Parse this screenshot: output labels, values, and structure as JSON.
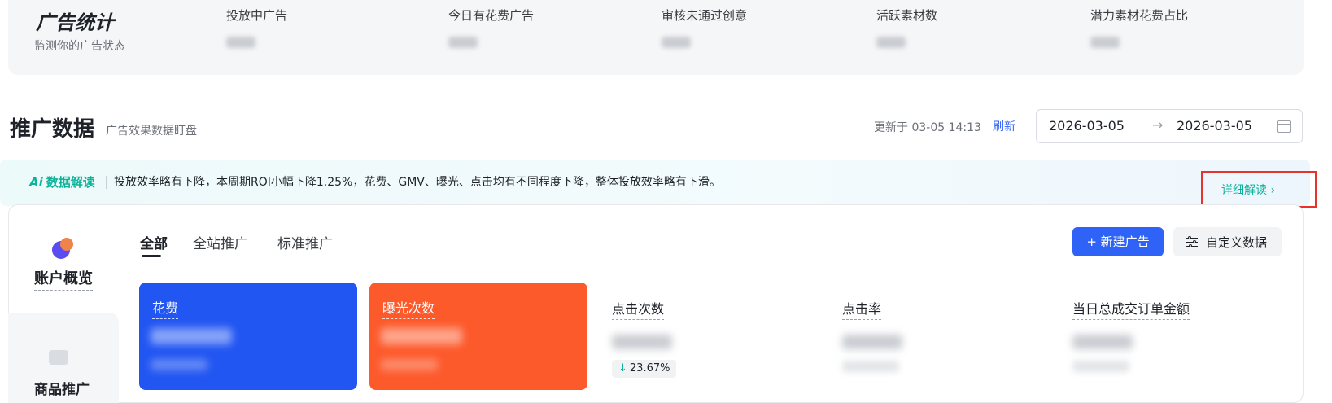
{
  "stats": {
    "title": "广告统计",
    "subtitle": "监测你的广告状态",
    "items": [
      {
        "label": "投放中广告"
      },
      {
        "label": "今日有花费广告"
      },
      {
        "label": "审核未通过创意"
      },
      {
        "label": "活跃素材数"
      },
      {
        "label": "潜力素材花费占比"
      }
    ]
  },
  "promo": {
    "title": "推广数据",
    "subtitle": "广告效果数据盯盘",
    "update_label": "更新于 03-05 14:13",
    "refresh_label": "刷新",
    "date_start": "2026-03-05",
    "date_arrow": "→",
    "date_end": "2026-03-05"
  },
  "ai": {
    "badge_mark": "Ai",
    "badge_label": "数据解读",
    "text": "投放效率略有下降，本周期ROI小幅下降1.25%，花费、GMV、曝光、点击均有不同程度下降，整体投放效率略有下滑。",
    "detail_label": "详细解读 ›"
  },
  "side": {
    "overview_label": "账户概览",
    "product_label": "商品推广"
  },
  "tabs": [
    {
      "label": "全部"
    },
    {
      "label": "全站推广"
    },
    {
      "label": "标准推广"
    }
  ],
  "actions": {
    "new_ad_label": "+ 新建广告",
    "custom_label": "自定义数据"
  },
  "metrics": {
    "spend_label": "花费",
    "impressions_label": "曝光次数",
    "clicks_label": "点击次数",
    "clicks_change": "23.67%",
    "ctr_label": "点击率",
    "gmv_label": "当日总成交订单金额"
  },
  "colors": {
    "accent_blue": "#2f62f6",
    "spend_card": "#2256f2",
    "impressions_card": "#fd5a2c",
    "ai_green": "#0ab39a",
    "highlight_red": "#e5342b"
  }
}
